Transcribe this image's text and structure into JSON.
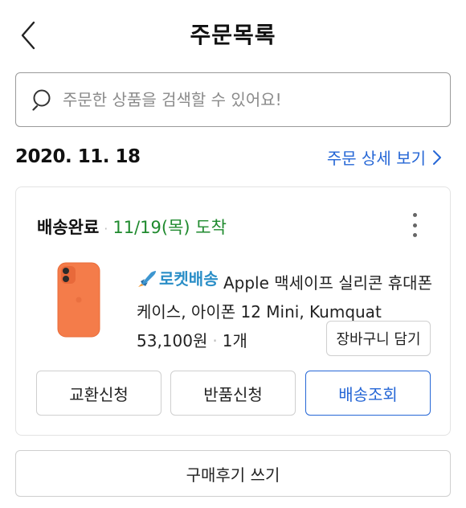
{
  "header": {
    "title": "주문목록",
    "back_icon": "chevron-left-icon"
  },
  "search": {
    "placeholder": "주문한 상품을 검색할 수 있어요!",
    "value": "",
    "icon": "search-icon"
  },
  "order": {
    "date": "2020. 11. 18",
    "detail_link": "주문 상세 보기",
    "detail_icon": "chevron-right-icon",
    "status": "배송완료",
    "arrival": "11/19(목) 도착",
    "more_icon": "more-vertical-icon",
    "product": {
      "badge": "로켓배송",
      "badge_icon": "rocket-icon",
      "name": "Apple 맥세이프 실리콘 휴대폰 케이스, 아이폰 12 Mini, Kumquat",
      "price": "53,100원",
      "quantity": "1개",
      "image_color": "#F47C4A"
    },
    "cart_button": "장바구니 담기",
    "actions": {
      "exchange": "교환신청",
      "return": "반품신청",
      "track": "배송조회"
    }
  },
  "review_button": "구매후기 쓰기",
  "colors": {
    "accent_blue": "#2667D6",
    "arrival_green": "#1F8A2E",
    "rocket_blue": "#2A8EC7"
  }
}
